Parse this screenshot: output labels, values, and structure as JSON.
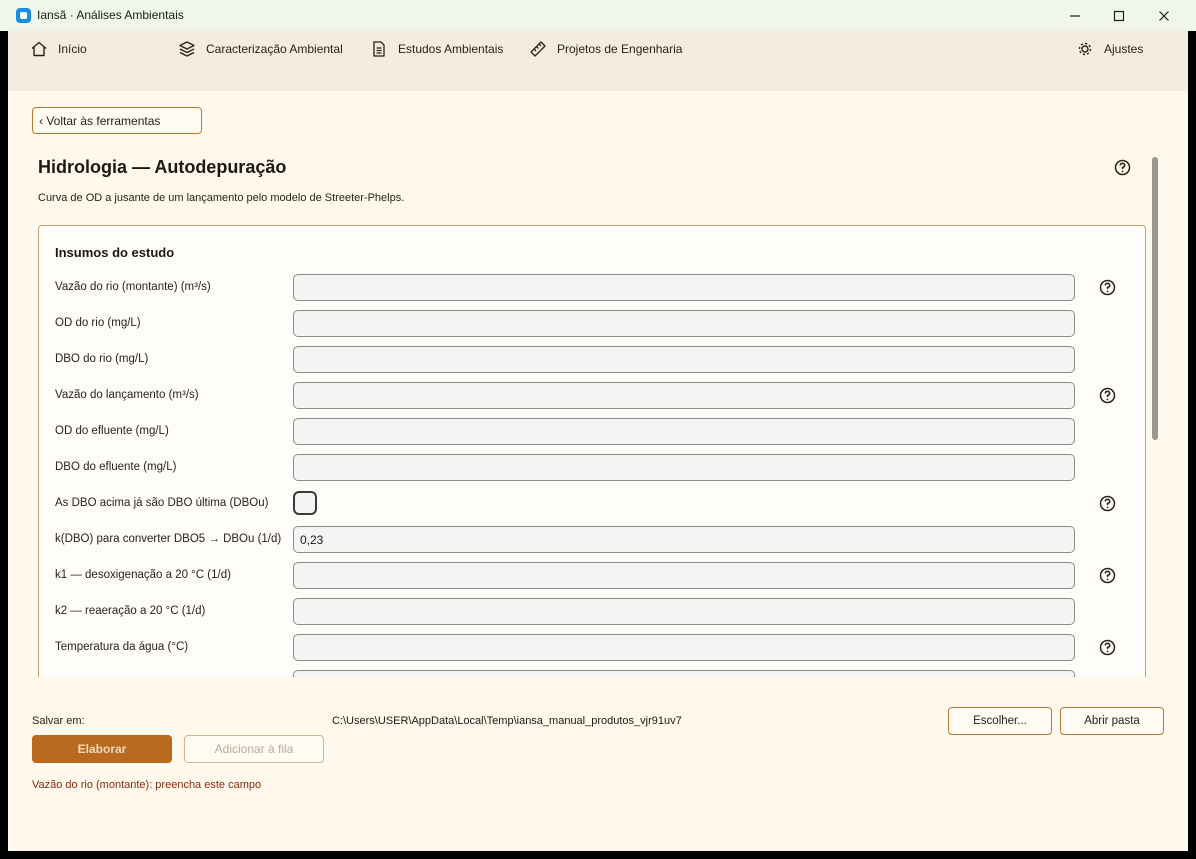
{
  "window": {
    "title": "Iansã · Análises Ambientais",
    "controls": {
      "minimize": "—",
      "maximize": "☐",
      "close": "✕"
    }
  },
  "nav": {
    "items": [
      {
        "label": "Início",
        "icon": "home-icon"
      },
      {
        "label": "Caracterização Ambiental",
        "icon": "layers-icon"
      },
      {
        "label": "Estudos Ambientais",
        "icon": "document-icon"
      },
      {
        "label": "Projetos de Engenharia",
        "icon": "ruler-icon"
      }
    ],
    "settings": {
      "label": "Ajustes",
      "icon": "gear-icon"
    }
  },
  "back_button": "‹ Voltar às ferramentas",
  "page": {
    "title": "Hidrologia — Autodepuração",
    "subtitle": "Curva de OD a jusante de um lançamento pelo modelo de Streeter-Phelps."
  },
  "panel": {
    "title": "Insumos do estudo",
    "fields": [
      {
        "label": "Vazão do rio (montante) (m³/s)",
        "type": "text",
        "value": "",
        "help": true
      },
      {
        "label": "OD do rio (mg/L)",
        "type": "text",
        "value": "",
        "help": false
      },
      {
        "label": "DBO do rio (mg/L)",
        "type": "text",
        "value": "",
        "help": false
      },
      {
        "label": "Vazão do lançamento (m³/s)",
        "type": "text",
        "value": "",
        "help": true
      },
      {
        "label": "OD do efluente (mg/L)",
        "type": "text",
        "value": "",
        "help": false
      },
      {
        "label": "DBO do efluente (mg/L)",
        "type": "text",
        "value": "",
        "help": false
      },
      {
        "label": "As DBO acima já são DBO última (DBOu)",
        "type": "checkbox",
        "checked": false,
        "help": true
      },
      {
        "label": "k(DBO) para converter DBO5 → DBOu (1/d)",
        "type": "text",
        "value": "0,23",
        "help": false
      },
      {
        "label": "k1 — desoxigenação a 20 °C (1/d)",
        "type": "text",
        "value": "",
        "help": true
      },
      {
        "label": "k2 — reaeração a 20 °C (1/d)",
        "type": "text",
        "value": "",
        "help": false
      },
      {
        "label": "Temperatura da água (°C)",
        "type": "text",
        "value": "",
        "help": true
      }
    ]
  },
  "footer": {
    "save_label": "Salvar em:",
    "save_path": "C:\\Users\\USER\\AppData\\Local\\Temp\\iansa_manual_produtos_vjr91uv7",
    "choose_button": "Escolher...",
    "open_folder_button": "Abrir pasta",
    "elaborate_button": "Elaborar",
    "queue_button": "Adicionar à fila",
    "error": "Vazão do rio (montante): preencha este campo"
  },
  "colors": {
    "accent": "#b86a20",
    "nav_bg": "#f4ece0",
    "content_bg": "#fff8ec",
    "error": "#8a2a10"
  }
}
